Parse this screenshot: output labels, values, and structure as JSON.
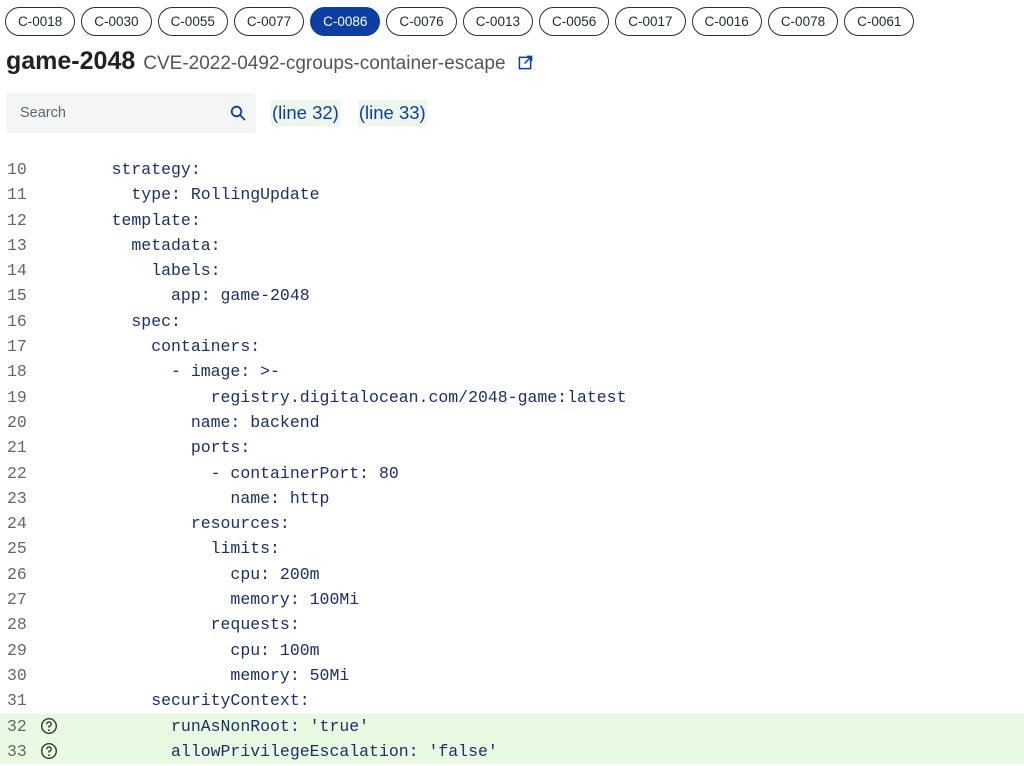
{
  "controls": [
    "C-0018",
    "C-0030",
    "C-0055",
    "C-0077",
    "C-0086",
    "C-0076",
    "C-0013",
    "C-0056",
    "C-0017",
    "C-0016",
    "C-0078",
    "C-0061"
  ],
  "active_control_index": 4,
  "header": {
    "app_name": "game-2048",
    "cve_name": "CVE-2022-0492-cgroups-container-escape",
    "external_link_icon": "external-link-icon"
  },
  "search": {
    "placeholder": "Search",
    "icon": "search-icon"
  },
  "line_links": [
    "(line 32)",
    "(line 33)"
  ],
  "code_lines": [
    {
      "n": "10",
      "text": "    strategy:",
      "highlight": false
    },
    {
      "n": "11",
      "text": "      type: RollingUpdate",
      "highlight": false
    },
    {
      "n": "12",
      "text": "    template:",
      "highlight": false
    },
    {
      "n": "13",
      "text": "      metadata:",
      "highlight": false
    },
    {
      "n": "14",
      "text": "        labels:",
      "highlight": false
    },
    {
      "n": "15",
      "text": "          app: game-2048",
      "highlight": false
    },
    {
      "n": "16",
      "text": "      spec:",
      "highlight": false
    },
    {
      "n": "17",
      "text": "        containers:",
      "highlight": false
    },
    {
      "n": "18",
      "text": "          - image: >-",
      "highlight": false
    },
    {
      "n": "19",
      "text": "              registry.digitalocean.com/2048-game:latest",
      "highlight": false
    },
    {
      "n": "20",
      "text": "            name: backend",
      "highlight": false
    },
    {
      "n": "21",
      "text": "            ports:",
      "highlight": false
    },
    {
      "n": "22",
      "text": "              - containerPort: 80",
      "highlight": false
    },
    {
      "n": "23",
      "text": "                name: http",
      "highlight": false
    },
    {
      "n": "24",
      "text": "            resources:",
      "highlight": false
    },
    {
      "n": "25",
      "text": "              limits:",
      "highlight": false
    },
    {
      "n": "26",
      "text": "                cpu: 200m",
      "highlight": false
    },
    {
      "n": "27",
      "text": "                memory: 100Mi",
      "highlight": false
    },
    {
      "n": "28",
      "text": "              requests:",
      "highlight": false
    },
    {
      "n": "29",
      "text": "                cpu: 100m",
      "highlight": false
    },
    {
      "n": "30",
      "text": "                memory: 50Mi",
      "highlight": false
    },
    {
      "n": "31",
      "text": "        securityContext:",
      "highlight": false
    },
    {
      "n": "32",
      "text": "          runAsNonRoot: 'true'",
      "highlight": true
    },
    {
      "n": "33",
      "text": "          allowPrivilegeEscalation: 'false'",
      "highlight": true
    }
  ],
  "colors": {
    "accent": "#0b3fa3",
    "highlight_bg": "#e9fae3",
    "code_text": "#1a2f6b"
  }
}
